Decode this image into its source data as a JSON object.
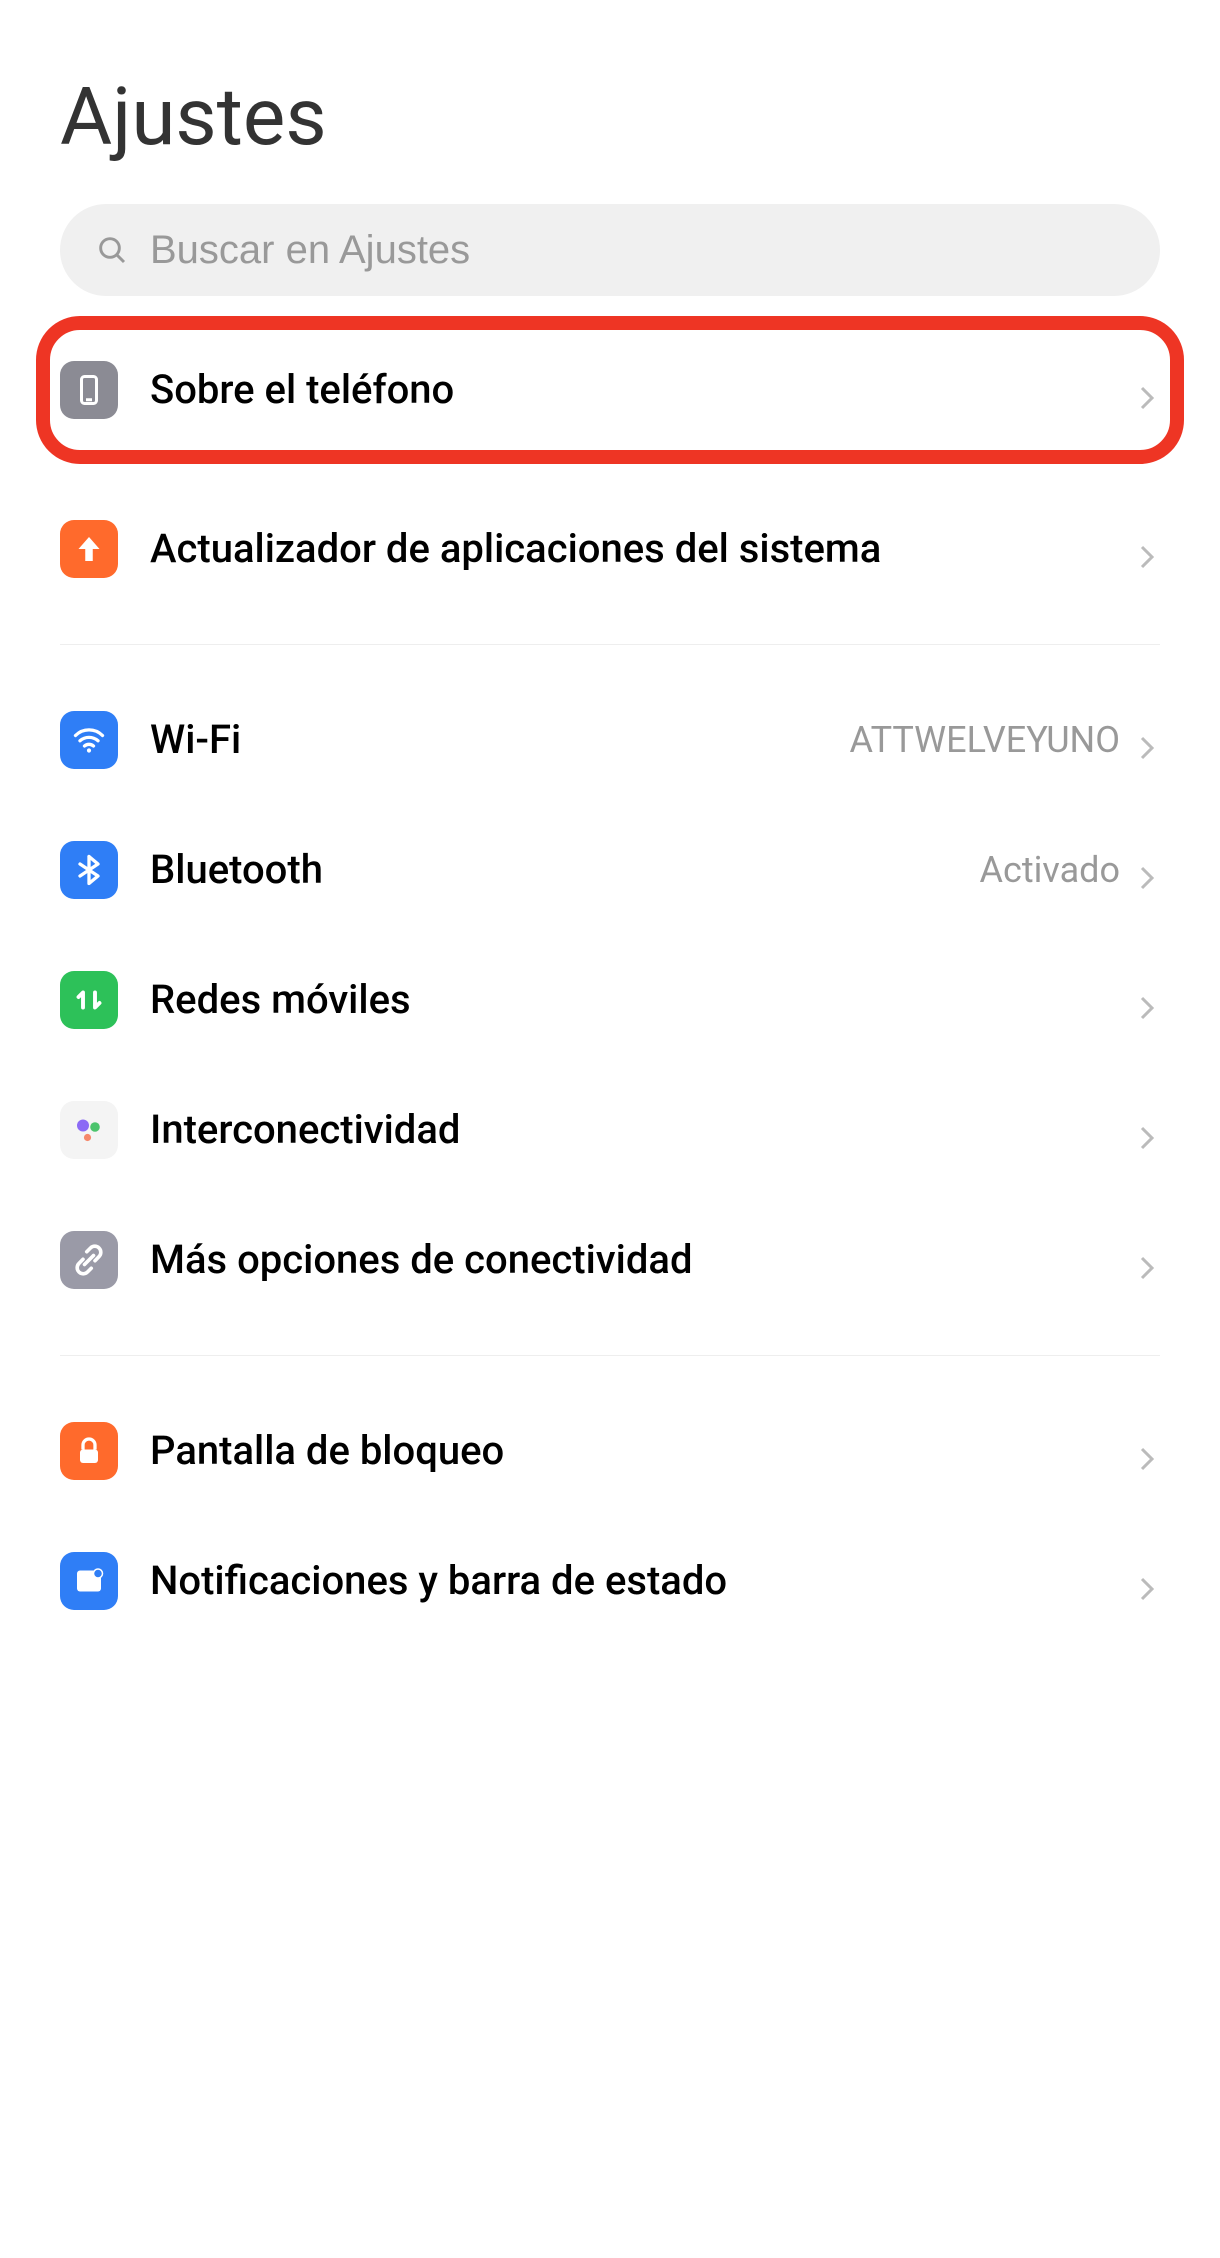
{
  "page_title": "Ajustes",
  "search": {
    "placeholder": "Buscar en Ajustes"
  },
  "rows": {
    "about": {
      "label": "Sobre el teléfono"
    },
    "update": {
      "label": "Actualizador de aplicaciones del sistema"
    },
    "wifi": {
      "label": "Wi-Fi",
      "value": "ATTWELVEYUNO"
    },
    "bluetooth": {
      "label": "Bluetooth",
      "value": "Activado"
    },
    "mobile": {
      "label": "Redes móviles"
    },
    "inter": {
      "label": "Interconectividad"
    },
    "more": {
      "label": "Más opciones de conectividad"
    },
    "lock": {
      "label": "Pantalla de bloqueo"
    },
    "notif": {
      "label": "Notificaciones y barra de estado"
    }
  }
}
